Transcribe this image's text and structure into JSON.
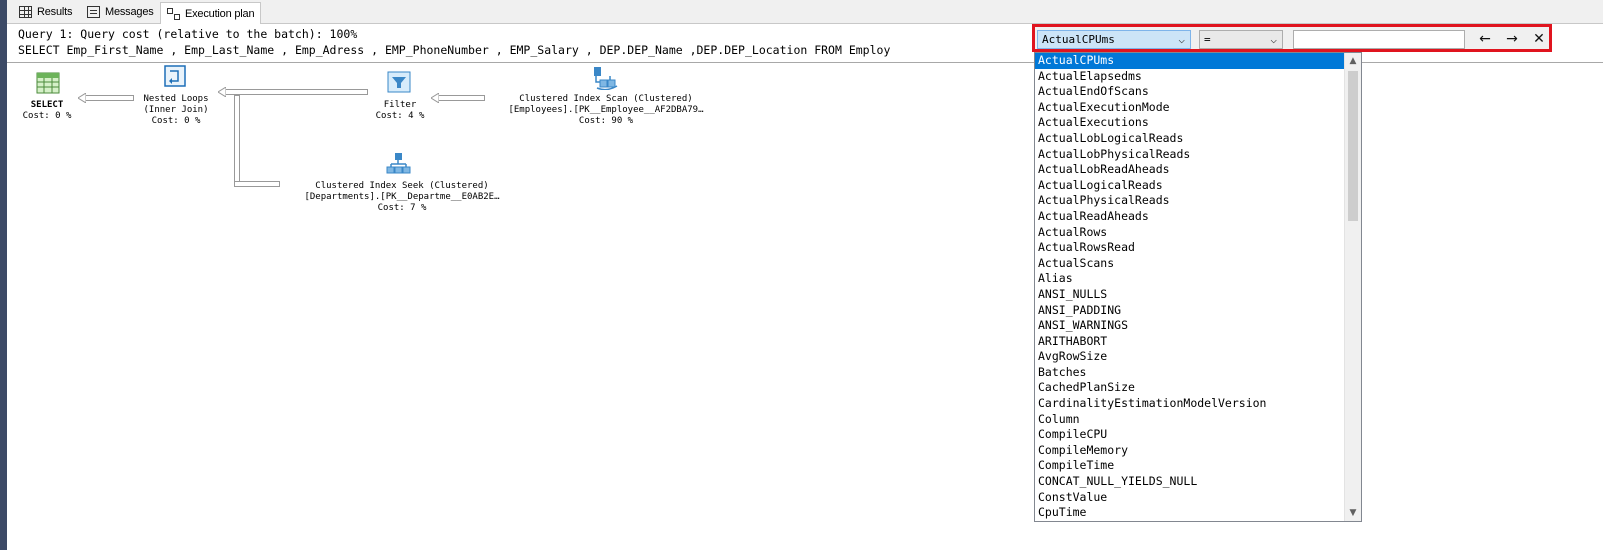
{
  "tabs": [
    {
      "label": "Results",
      "icon": "results-grid-icon"
    },
    {
      "label": "Messages",
      "icon": "messages-icon"
    },
    {
      "label": "Execution plan",
      "icon": "execution-plan-icon"
    }
  ],
  "query": {
    "line1": "Query 1: Query cost (relative to the batch): 100%",
    "line2": "SELECT Emp_First_Name , Emp_Last_Name , Emp_Adress , EMP_PhoneNumber , EMP_Salary , DEP.DEP_Name ,DEP.DEP_Location FROM Employ"
  },
  "plan": {
    "select": {
      "name": "SELECT",
      "cost": "Cost: 0 %"
    },
    "nested_loops": {
      "name": "Nested Loops",
      "sub": "(Inner Join)",
      "cost": "Cost: 0 %"
    },
    "filter": {
      "name": "Filter",
      "cost": "Cost: 4 %"
    },
    "scan": {
      "name": "Clustered Index Scan (Clustered)",
      "object": "[Employees].[PK__Employee__AF2DBA79…",
      "cost": "Cost: 90 %"
    },
    "seek": {
      "name": "Clustered Index Seek (Clustered)",
      "object": "[Departments].[PK__Departme__E0AB2E…",
      "cost": "Cost: 7 %"
    }
  },
  "findbar": {
    "property": "ActualCPUms",
    "operator": "=",
    "value": "",
    "prev_icon": "←",
    "next_icon": "→",
    "close_icon": "✕"
  },
  "dropdown": {
    "selected_index": 0,
    "items": [
      "ActualCPUms",
      "ActualElapsedms",
      "ActualEndOfScans",
      "ActualExecutionMode",
      "ActualExecutions",
      "ActualLobLogicalReads",
      "ActualLobPhysicalReads",
      "ActualLobReadAheads",
      "ActualLogicalReads",
      "ActualPhysicalReads",
      "ActualReadAheads",
      "ActualRows",
      "ActualRowsRead",
      "ActualScans",
      "Alias",
      "ANSI_NULLS",
      "ANSI_PADDING",
      "ANSI_WARNINGS",
      "ARITHABORT",
      "AvgRowSize",
      "Batches",
      "CachedPlanSize",
      "CardinalityEstimationModelVersion",
      "Column",
      "CompileCPU",
      "CompileMemory",
      "CompileTime",
      "CONCAT_NULL_YIELDS_NULL",
      "ConstValue",
      "CpuTime"
    ]
  },
  "colors": {
    "highlight_border": "#e0141e",
    "selection": "#0078d7",
    "combo_active": "#cce4f7"
  }
}
